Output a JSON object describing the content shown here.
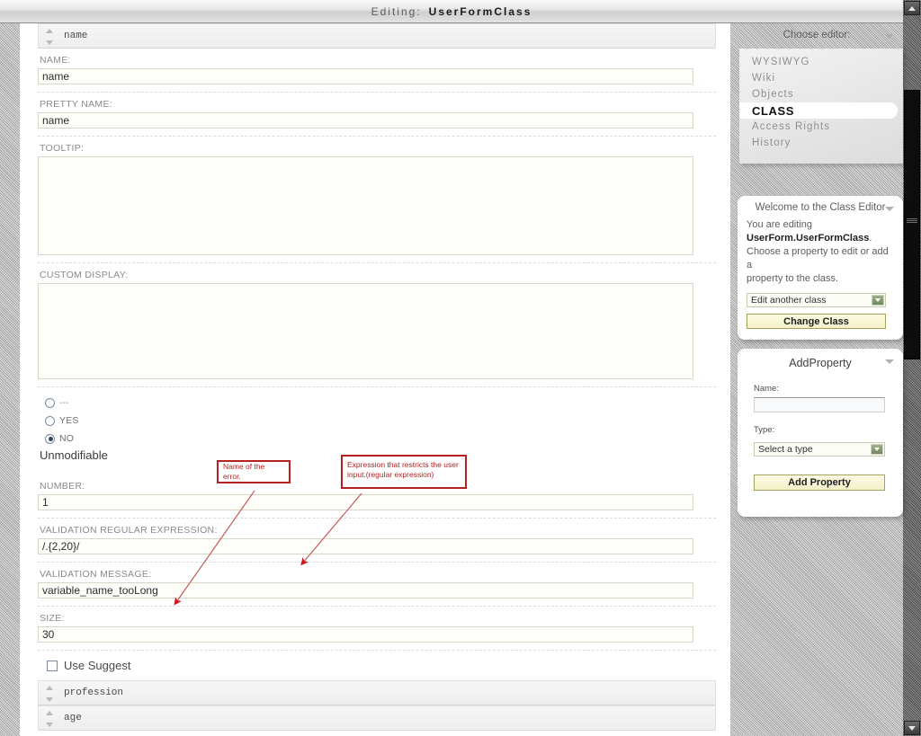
{
  "window": {
    "title_label": "Editing:",
    "title_doc": "UserFormClass"
  },
  "property_sections": {
    "expanded": {
      "name": "name"
    },
    "collapsed": [
      {
        "name": "profession"
      },
      {
        "name": "age"
      }
    ]
  },
  "form": {
    "name": {
      "label": "NAME:",
      "value": "name"
    },
    "pretty_name": {
      "label": "PRETTY NAME:",
      "value": "name"
    },
    "tooltip": {
      "label": "TOOLTIP:",
      "value": ""
    },
    "custom_display": {
      "label": "CUSTOM DISPLAY:",
      "value": ""
    },
    "unmodifiable": {
      "caption": "Unmodifiable",
      "options": [
        {
          "label": "---",
          "selected": false
        },
        {
          "label": "YES",
          "selected": false
        },
        {
          "label": "NO",
          "selected": true
        }
      ]
    },
    "number": {
      "label": "NUMBER:",
      "value": "1"
    },
    "validation_regex": {
      "label": "VALIDATION REGULAR EXPRESSION:",
      "value": "/.{2,20}/"
    },
    "validation_message": {
      "label": "VALIDATION MESSAGE:",
      "value": "variable_name_tooLong"
    },
    "size": {
      "label": "SIZE:",
      "value": "30"
    },
    "use_suggest": {
      "label": "Use Suggest",
      "checked": false
    }
  },
  "editor_chooser": {
    "title": "Choose editor:",
    "items": [
      {
        "label": "WYSIWYG",
        "active": false
      },
      {
        "label": "Wiki",
        "active": false
      },
      {
        "label": "Objects",
        "active": false
      },
      {
        "label": "CLASS",
        "active": true
      },
      {
        "label": "Access Rights",
        "active": false
      },
      {
        "label": "History",
        "active": false
      }
    ]
  },
  "welcome_panel": {
    "title": "Welcome to the Class Editor",
    "line1": "You are editing",
    "class_name": "UserForm.UserFormClass",
    "period": ".",
    "line2": "Choose a property to edit or add a",
    "line3": "property to the class.",
    "select_value": "Edit another class",
    "button_label": "Change Class"
  },
  "add_property_panel": {
    "title": "AddProperty",
    "name_label": "Name:",
    "name_value": "",
    "name_placeholder": "",
    "type_label": "Type:",
    "type_value": "Select a type",
    "button_label": "Add Property"
  },
  "annotations": [
    {
      "id": "error-name",
      "text": "Name of the error."
    },
    {
      "id": "regex-note",
      "text": "Expression that restricts the user input.(regular expression)"
    }
  ],
  "colors": {
    "annotation_red": "#b41f1f",
    "panel_white": "#ffffff",
    "input_border": "#d7d7c9",
    "gold_button": "#f3f0c9"
  }
}
